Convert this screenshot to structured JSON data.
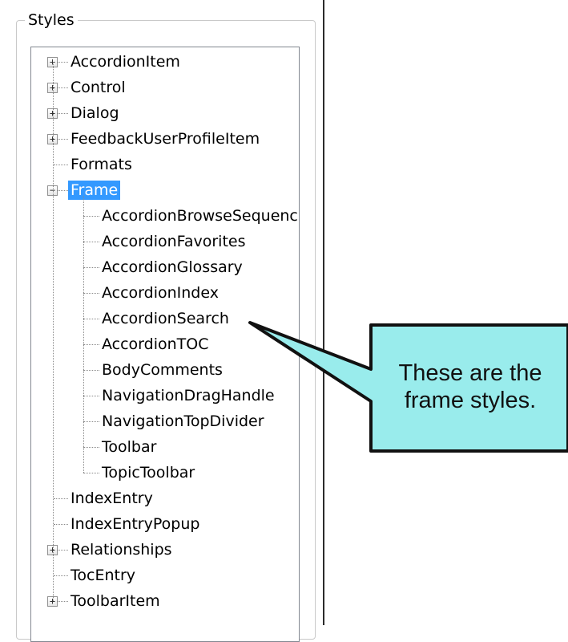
{
  "panel": {
    "title": "Styles"
  },
  "tree": {
    "items": [
      {
        "label": "AccordionItem",
        "level": 0,
        "expander": "+"
      },
      {
        "label": "Control",
        "level": 0,
        "expander": "+"
      },
      {
        "label": "Dialog",
        "level": 0,
        "expander": "+"
      },
      {
        "label": "FeedbackUserProfileItem",
        "level": 0,
        "expander": "+"
      },
      {
        "label": "Formats",
        "level": 0,
        "expander": ""
      },
      {
        "label": "Frame",
        "level": 0,
        "expander": "−",
        "selected": true
      },
      {
        "label": "AccordionBrowseSequenc",
        "level": 1,
        "expander": ""
      },
      {
        "label": "AccordionFavorites",
        "level": 1,
        "expander": ""
      },
      {
        "label": "AccordionGlossary",
        "level": 1,
        "expander": ""
      },
      {
        "label": "AccordionIndex",
        "level": 1,
        "expander": ""
      },
      {
        "label": "AccordionSearch",
        "level": 1,
        "expander": ""
      },
      {
        "label": "AccordionTOC",
        "level": 1,
        "expander": ""
      },
      {
        "label": "BodyComments",
        "level": 1,
        "expander": ""
      },
      {
        "label": "NavigationDragHandle",
        "level": 1,
        "expander": ""
      },
      {
        "label": "NavigationTopDivider",
        "level": 1,
        "expander": ""
      },
      {
        "label": "Toolbar",
        "level": 1,
        "expander": ""
      },
      {
        "label": "TopicToolbar",
        "level": 1,
        "expander": ""
      },
      {
        "label": "IndexEntry",
        "level": 0,
        "expander": ""
      },
      {
        "label": "IndexEntryPopup",
        "level": 0,
        "expander": ""
      },
      {
        "label": "Relationships",
        "level": 0,
        "expander": "+"
      },
      {
        "label": "TocEntry",
        "level": 0,
        "expander": ""
      },
      {
        "label": "ToolbarItem",
        "level": 0,
        "expander": "+"
      }
    ]
  },
  "callout": {
    "text_line1": "These are the",
    "text_line2": "frame styles.",
    "fill_color": "#99ecec",
    "border_color": "#111111"
  },
  "colors": {
    "selection": "#3399ff"
  }
}
